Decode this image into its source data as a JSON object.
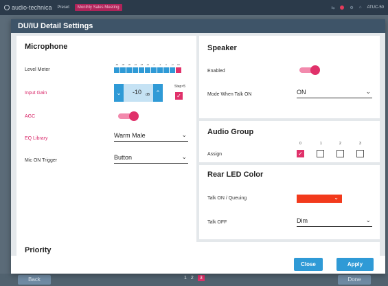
{
  "app": {
    "brand": "audio-technica",
    "preset_label": "Preset",
    "preset_value": "Monthly Sales Meeting",
    "model": "ATUC-50"
  },
  "background": {
    "back_label": "Back",
    "done_label": "Done",
    "pages": [
      "1",
      "2",
      "3"
    ],
    "current_page": "3"
  },
  "modal": {
    "title": "DU/IU Detail Settings",
    "close_label": "Close",
    "apply_label": "Apply",
    "priority_title": "Priority"
  },
  "microphone": {
    "title": "Microphone",
    "level_meter_label": "Level Meter",
    "meter_ticks": [
      "-60",
      "-48",
      "-36",
      "-24",
      "-18",
      "-12",
      "-6",
      "-3",
      "0",
      "+3",
      "OV"
    ],
    "input_gain_label": "Input Gain",
    "input_gain_value": "-10",
    "input_gain_unit": "dB",
    "step_label": "Step×5",
    "agc_label": "AGC",
    "eq_label": "EQ Library",
    "eq_value": "Warm Male",
    "trigger_label": "Mic ON Trigger",
    "trigger_value": "Button"
  },
  "speaker": {
    "title": "Speaker",
    "enabled_label": "Enabled",
    "mode_label": "Mode When Talk ON",
    "mode_value": "ON"
  },
  "audio_group": {
    "title": "Audio Group",
    "assign_label": "Assign",
    "groups": [
      "0",
      "1",
      "2",
      "3"
    ]
  },
  "rear_led": {
    "title": "Rear LED Color",
    "talk_on_label": "Talk ON / Queuing",
    "talk_on_color": "#f23a1c",
    "talk_off_label": "Talk OFF",
    "talk_off_value": "Dim"
  },
  "colors": {
    "accent": "#e0316a",
    "primary": "#2f9ad6",
    "header": "#3e5468"
  }
}
